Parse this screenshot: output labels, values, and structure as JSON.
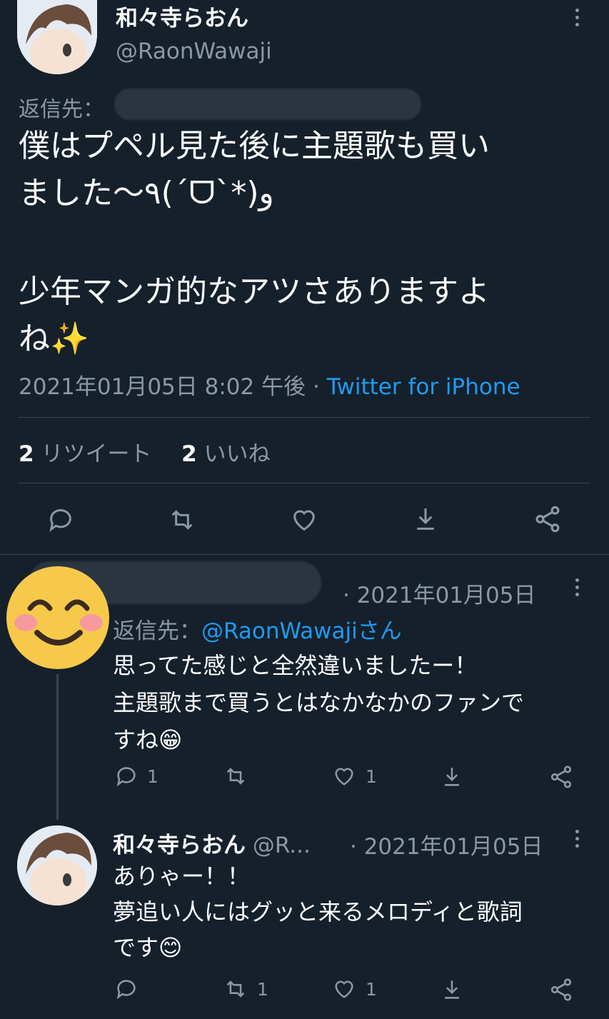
{
  "main_tweet": {
    "display_name": "和々寺らおん",
    "handle": "@RaonWawaji",
    "reply_to_label": "返信先：",
    "body_line1": "僕はプペル見た後に主題歌も買い",
    "body_line2": "ました〜٩(ˊᗜˋ*)و",
    "body_line3": "少年マンガ的なアツさありますよ",
    "body_line4": "ね✨",
    "timestamp": "2021年01月05日 8:02 午後",
    "dot": "·",
    "source": "Twitter for iPhone",
    "retweet_count": "2",
    "retweet_label": "リツイート",
    "like_count": "2",
    "like_label": "いいね"
  },
  "reply1": {
    "avatar_emoji": "😊",
    "timestamp": "· 2021年01月05日",
    "reply_to_label": "返信先：",
    "reply_to_handle": "@RaonWawajiさん",
    "line1": "思ってた感じと全然違いましたー！",
    "line2": "主題歌まで買うとはなかなかのファンで",
    "line3": "すね😁",
    "reply_count": "1",
    "retweet_count": "",
    "like_count": "1"
  },
  "reply2": {
    "display_name": "和々寺らおん",
    "handle": "@R...",
    "timestamp": "· 2021年01月05日",
    "line1": "ありゃー！！",
    "line2": "夢追い人にはグッと来るメロディと歌詞",
    "line3": "です😊",
    "reply_count": "",
    "retweet_count": "1",
    "like_count": "1"
  },
  "colors": {
    "background": "#15202b",
    "muted": "#8b98a5",
    "link": "#1d9bf0",
    "separator": "#38444d"
  },
  "icons": [
    "reply-icon",
    "retweet-icon",
    "like-icon",
    "download-icon",
    "share-icon",
    "more-icon"
  ]
}
